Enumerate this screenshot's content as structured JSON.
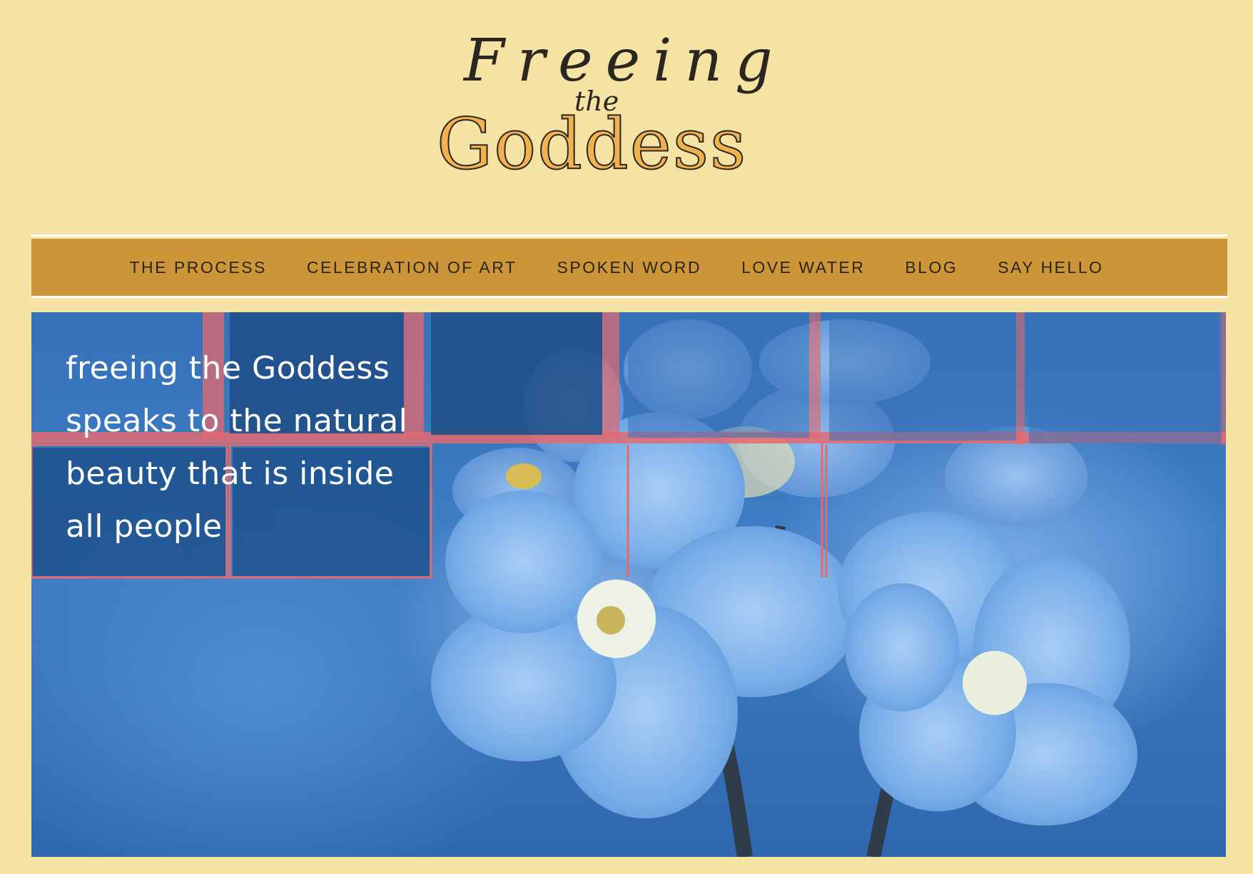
{
  "logo": {
    "line1": "Freeing",
    "line2": "the",
    "line3": "Goddess"
  },
  "nav": {
    "items": [
      {
        "label": "THE PROCESS"
      },
      {
        "label": "CELEBRATION OF ART"
      },
      {
        "label": "SPOKEN WORD"
      },
      {
        "label": "LOVE WATER"
      },
      {
        "label": "BLOG"
      },
      {
        "label": "SAY HELLO"
      }
    ]
  },
  "hero": {
    "text_lines": [
      "freeing the Goddess",
      "speaks to the natural",
      "beauty that is inside",
      "all people"
    ]
  },
  "colors": {
    "background": "#f4e3a3",
    "nav": "#cb9538",
    "logo_fill": "#f1b14f",
    "logo_ink": "#2b2620",
    "hero_blue": "#3d7dc4"
  }
}
